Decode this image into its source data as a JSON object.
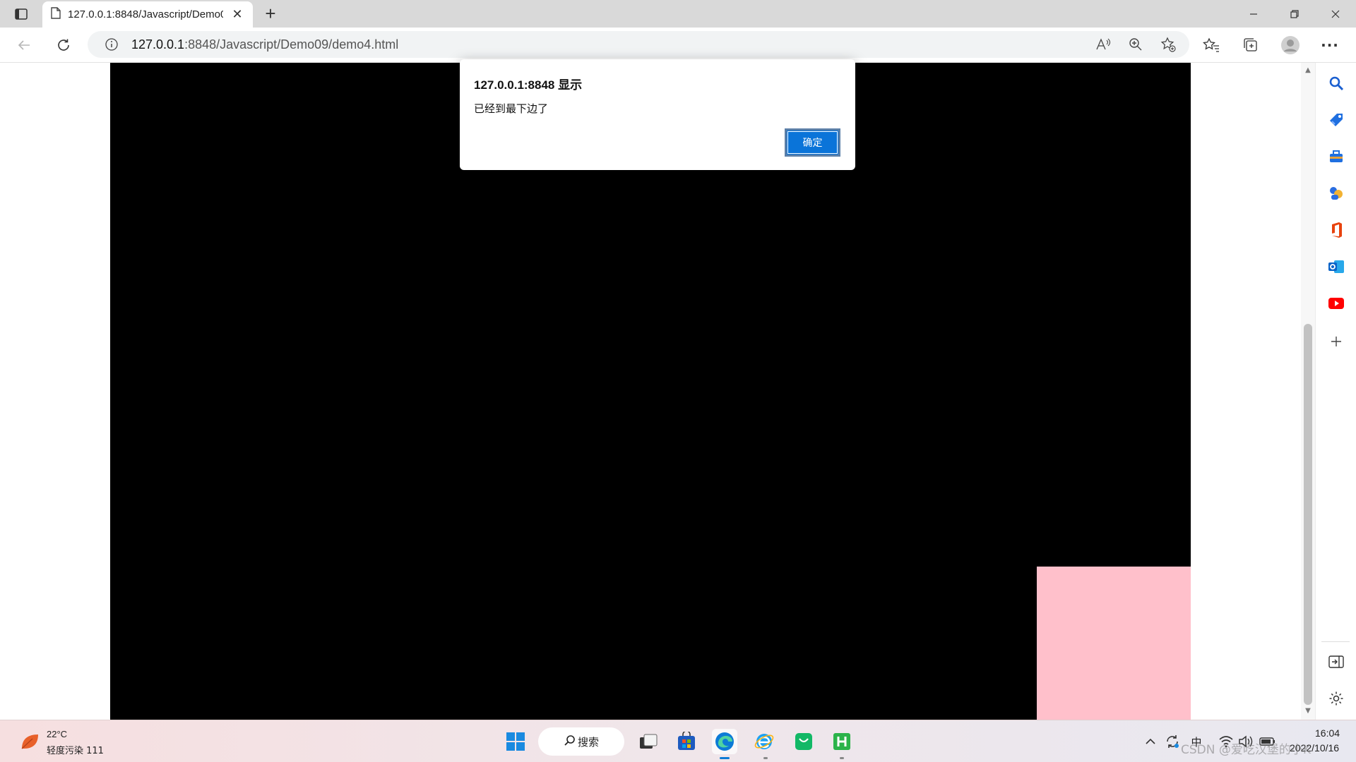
{
  "browser": {
    "tab": {
      "title": "127.0.0.1:8848/Javascript/Demo09/demo4.html"
    },
    "address": {
      "host": "127.0.0.1",
      "rest": ":8848/Javascript/Demo09/demo4.html"
    },
    "icons": {
      "tab_actions": "tab-actions-icon",
      "page": "page-icon",
      "close": "close-icon",
      "new_tab": "+",
      "back": "back-icon",
      "refresh": "refresh-icon",
      "info": "info-icon",
      "read_aloud": "read-aloud-icon",
      "zoom": "zoom-icon",
      "add_favorite": "add-favorite-icon",
      "favorites": "favorites-icon",
      "collections": "collections-icon",
      "profile": "profile-icon",
      "more": "···"
    }
  },
  "sidebar": {
    "items": [
      "search",
      "shopping",
      "tools",
      "games",
      "office",
      "outlook",
      "youtube",
      "add"
    ],
    "bottom": [
      "hide-sidebar",
      "settings"
    ]
  },
  "dialog": {
    "title": "127.0.0.1:8848 显示",
    "message": "已经到最下边了",
    "ok_label": "确定"
  },
  "page": {
    "colors": {
      "background_box": "#000000",
      "moving_box": "#ffc0cb"
    }
  },
  "taskbar": {
    "weather": {
      "temp": "22°C",
      "desc": "轻度污染 111"
    },
    "search_label": "搜索",
    "ime": "中",
    "time": "16:04",
    "date": "2022/10/16",
    "watermark": "CSDN @爱吃汉堡的小K"
  }
}
